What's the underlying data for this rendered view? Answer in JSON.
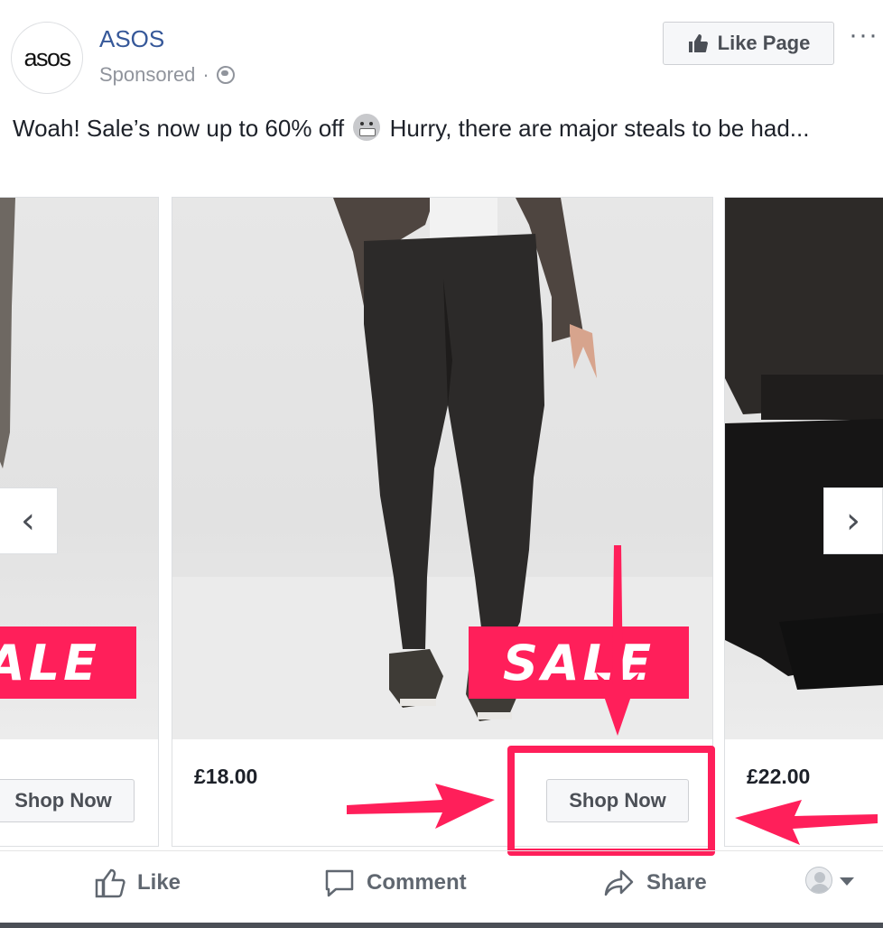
{
  "post": {
    "page_name": "ASOS",
    "avatar_text": "asos",
    "sponsored_label": "Sponsored",
    "separator": "·",
    "like_page_label": "Like Page",
    "more_label": "···",
    "text": "Woah! Sale’s now up to 60% off",
    "text_tail": "Hurry, there are major steals to be had..."
  },
  "carousel": {
    "cards": [
      {
        "price": "",
        "cta": "Shop Now",
        "badge": "ALE"
      },
      {
        "price": "£18.00",
        "cta": "Shop Now",
        "badge": "SALE"
      },
      {
        "price": "£22.00",
        "cta": ""
      }
    ],
    "prev_icon": "chevron-left-icon",
    "next_icon": "chevron-right-icon"
  },
  "actions": {
    "like": "Like",
    "comment": "Comment",
    "share": "Share"
  },
  "colors": {
    "accent": "#ff1f5a",
    "link": "#365899",
    "muted": "#90949c"
  }
}
